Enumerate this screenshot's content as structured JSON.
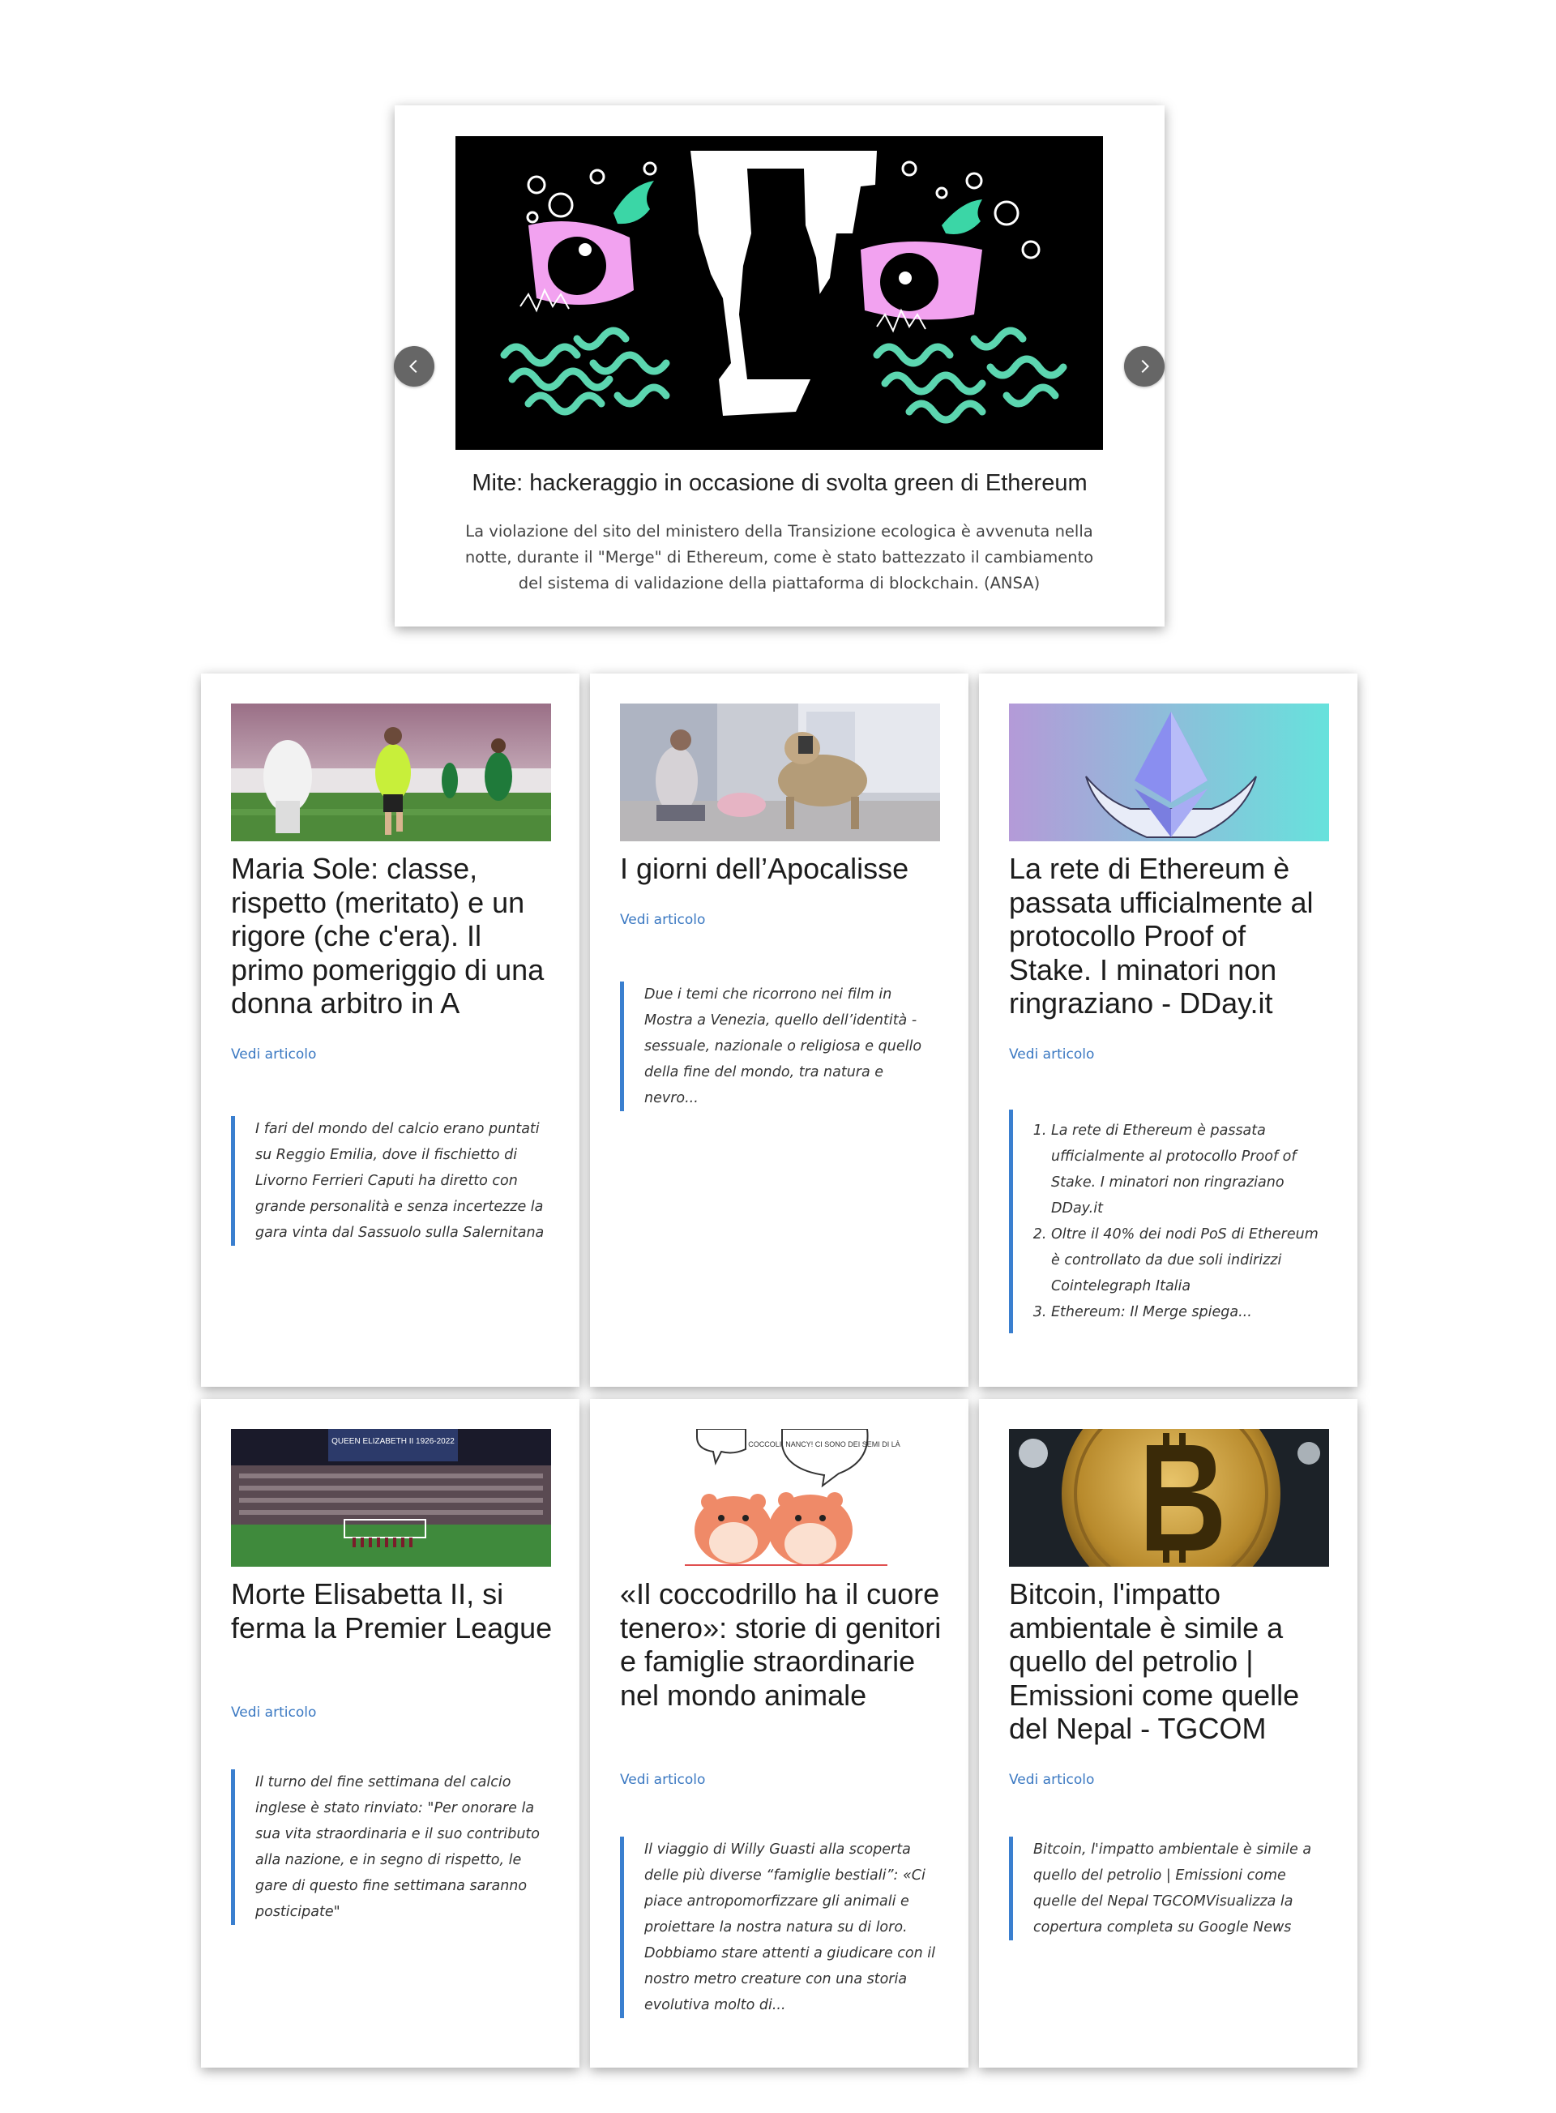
{
  "carousel": {
    "title": "Mite: hackeraggio in occasione di svolta green di Ethereum",
    "caption": "La violazione del sito del ministero della Transizione ecologica è avvenuta nella notte, durante il \"Merge\" di Ethereum, come è stato battezzato il cambiamento del sistema di validazione della piattaforma di blockchain. (ANSA)",
    "prev_icon": "chevron-left-icon",
    "next_icon": "chevron-right-icon"
  },
  "cards": [
    {
      "title": "Maria Sole: classe, rispetto (meritato) e un rigore (che c'era). Il primo pomeriggio di una donna arbitro in A",
      "link": "Vedi articolo",
      "excerpt": "I fari del mondo del calcio erano puntati su Reggio Emilia, dove il fischietto di Livorno Ferrieri Caputi ha diretto con grande personalità e senza incertezze la gara vinta dal Sassuolo sulla Salernitana"
    },
    {
      "title": "I giorni dell’Apocalisse",
      "link": "Vedi articolo",
      "excerpt": "Due i temi che ricorrono nei film in Mostra a Venezia, quello dell’identità - sessuale, nazionale o religiosa e quello della fine del mondo, tra natura e nevro..."
    },
    {
      "title": "La rete di Ethereum è passata ufficialmente al protocollo Proof of Stake. I minatori non ringraziano - DDay.it",
      "link": "Vedi articolo",
      "excerpt_items": [
        "La rete di Ethereum è passata ufficialmente al protocollo Proof of Stake. I minatori non ringraziano  DDay.it",
        "Oltre il 40% dei nodi PoS di Ethereum è controllato da due soli indirizzi  Cointelegraph Italia",
        "Ethereum: Il Merge spiega..."
      ]
    },
    {
      "title": "Morte Elisabetta II, si ferma la Premier League",
      "link": "Vedi articolo",
      "image_text": "QUEEN ELIZABETH II 1926-2022",
      "excerpt": "Il turno del fine settimana del calcio inglese è stato rinviato: \"Per onorare la sua vita straordinaria e il suo contributo alla nazione, e in segno di rispetto, le gare di questo fine settimana saranno posticipate\""
    },
    {
      "title": "«Il coccodrillo ha il cuore tenero»: storie di genitori e famiglie straordinarie nel mondo animale",
      "link": "Vedi articolo",
      "image_text": "COCCOLI, NANCY! CI SONO DEI SEMI DI LÀ",
      "excerpt": "Il viaggio di Willy Guasti alla scoperta delle più diverse “famiglie bestiali”: «Ci piace antropomorfizzare gli animali e proiettare la nostra natura su di loro. Dobbiamo stare attenti a giudicare con il nostro metro creature con una storia evolutiva molto di..."
    },
    {
      "title": "Bitcoin, l'impatto ambientale è simile a quello del petrolio | Emissioni come quelle del Nepal - TGCOM",
      "link": "Vedi articolo",
      "excerpt": "Bitcoin, l'impatto ambientale è simile a quello del petrolio | Emissioni come quelle del Nepal  TGCOMVisualizza la copertura completa su Google News"
    }
  ]
}
